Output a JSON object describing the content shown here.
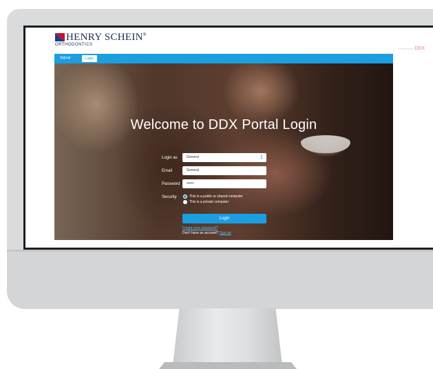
{
  "brand": {
    "name": "HENRY SCHEIN",
    "registered": "®",
    "subtitle": "ORTHODONTICS",
    "powered_by_label": "Powered by",
    "powered_by_brand": "DDX",
    "mark_colors": [
      "#c8102e",
      "#1b3f8b"
    ]
  },
  "nav": {
    "signup": "Signup",
    "login": "Login",
    "color": "#1b9fe0"
  },
  "hero": {
    "title": "Welcome to DDX Portal Login"
  },
  "form": {
    "login_as_label": "Login as",
    "login_as_value": "General",
    "email_label": "Email",
    "email_value": "General",
    "password_label": "Password",
    "password_value": "••••••",
    "security_label": "Security",
    "security_options": [
      {
        "label": "This is a public or shared computer",
        "selected": true
      },
      {
        "label": "This is a private computer",
        "selected": false
      }
    ],
    "submit": "Login",
    "forgot": "Forgot your password?",
    "no_account": "Don't have an account?",
    "signup_link": "Sign up"
  }
}
